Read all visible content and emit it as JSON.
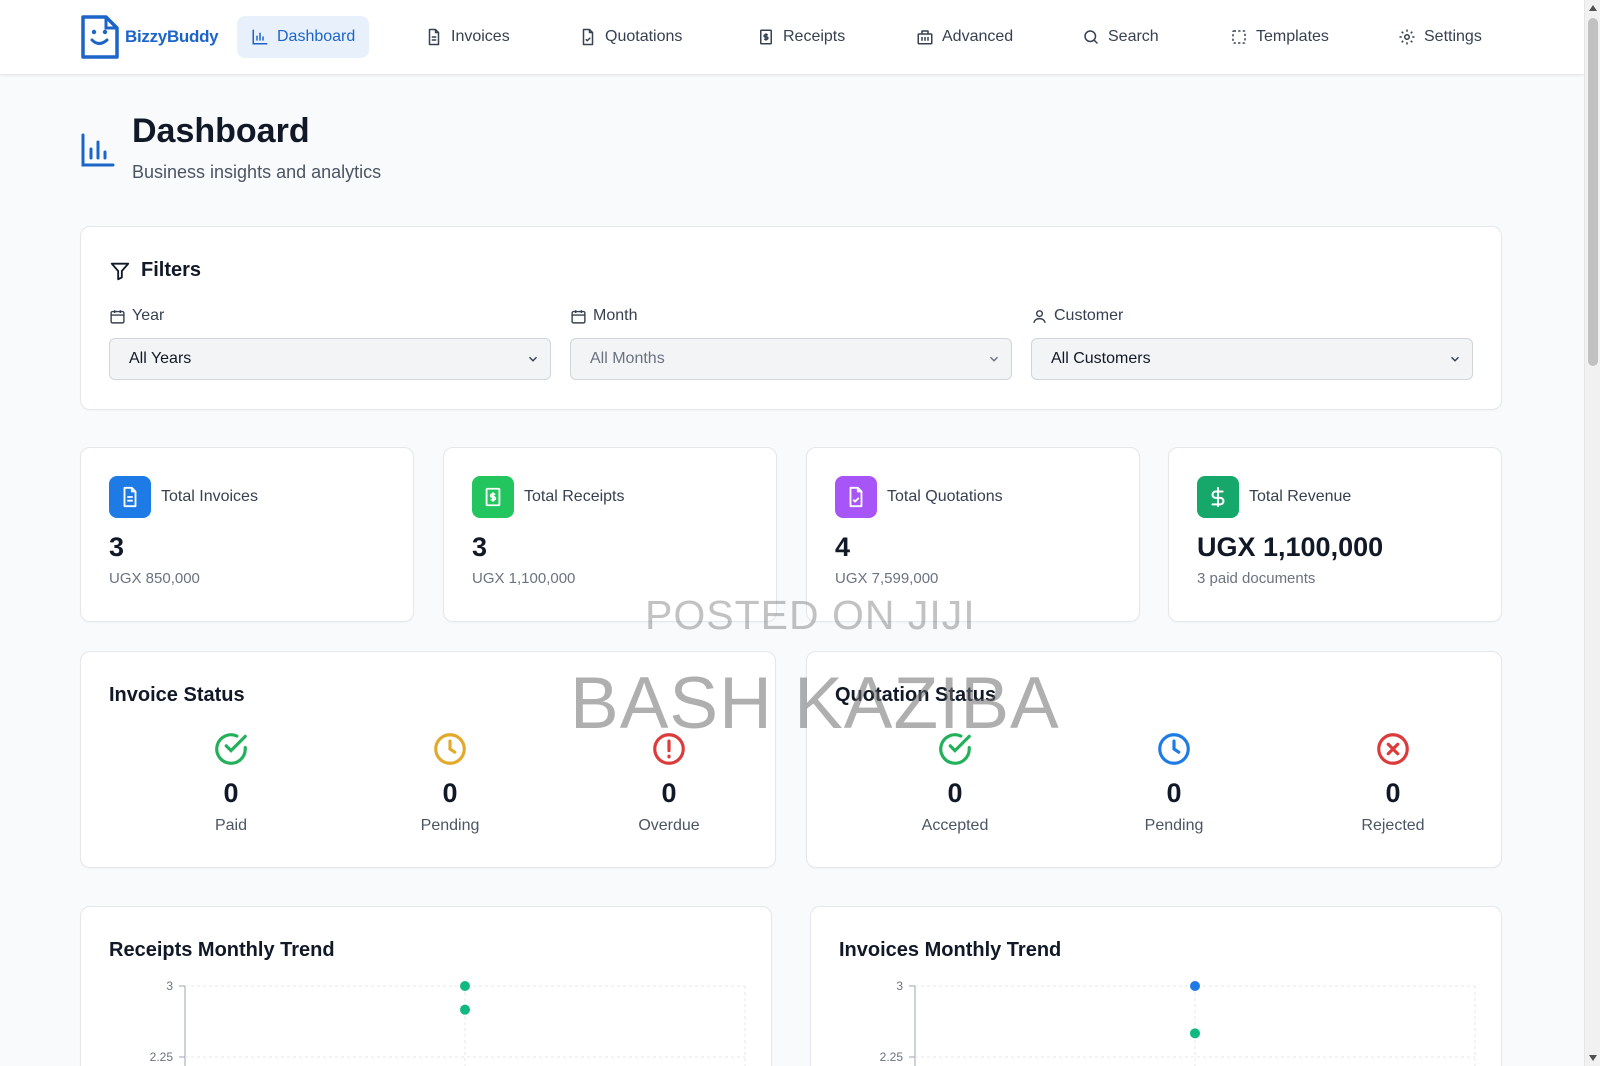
{
  "app": {
    "name": "BizzyBuddy"
  },
  "nav": {
    "dashboard": "Dashboard",
    "invoices": "Invoices",
    "quotations": "Quotations",
    "receipts": "Receipts",
    "advanced": "Advanced",
    "search": "Search",
    "templates": "Templates",
    "settings": "Settings",
    "active": "Dashboard"
  },
  "header": {
    "title": "Dashboard",
    "subtitle": "Business insights and analytics"
  },
  "filters": {
    "title": "Filters",
    "year": {
      "label": "Year",
      "value": "All Years"
    },
    "month": {
      "label": "Month",
      "value": "All Months"
    },
    "customer": {
      "label": "Customer",
      "value": "All Customers"
    }
  },
  "stats": {
    "invoices": {
      "label": "Total Invoices",
      "value": "3",
      "sub": "UGX 850,000",
      "color": "#1e7be6"
    },
    "receipts": {
      "label": "Total Receipts",
      "value": "3",
      "sub": "UGX 1,100,000",
      "color": "#22c55e"
    },
    "quotations": {
      "label": "Total Quotations",
      "value": "4",
      "sub": "UGX 7,599,000",
      "color": "#a855f7"
    },
    "revenue": {
      "label": "Total Revenue",
      "value": "UGX 1,100,000",
      "sub": "3 paid documents",
      "color": "#16a86a"
    }
  },
  "invoice_status": {
    "title": "Invoice Status",
    "paid": {
      "label": "Paid",
      "value": "0",
      "color": "#22b05a"
    },
    "pending": {
      "label": "Pending",
      "value": "0",
      "color": "#e3a92b"
    },
    "overdue": {
      "label": "Overdue",
      "value": "0",
      "color": "#dc3b3b"
    }
  },
  "quotation_status": {
    "title": "Quotation Status",
    "accepted": {
      "label": "Accepted",
      "value": "0",
      "color": "#22b05a"
    },
    "pending": {
      "label": "Pending",
      "value": "0",
      "color": "#1e7be6"
    },
    "rejected": {
      "label": "Rejected",
      "value": "0",
      "color": "#dc3b3b"
    }
  },
  "watermark": {
    "line1": "POSTED ON JIJI",
    "line2": "BASH KAZIBA"
  },
  "chart_data": [
    {
      "type": "scatter",
      "title": "Receipts Monthly Trend",
      "ytick_labels": [
        "3",
        "2.25"
      ],
      "series": [
        {
          "color": "#10b981",
          "x": [
            1
          ],
          "y": [
            3
          ]
        },
        {
          "color": "#10b981",
          "x": [
            1
          ],
          "y": [
            2.75
          ]
        }
      ]
    },
    {
      "type": "scatter",
      "title": "Invoices Monthly Trend",
      "ytick_labels": [
        "3",
        "2.25"
      ],
      "series": [
        {
          "color": "#1e7be6",
          "x": [
            1
          ],
          "y": [
            3
          ]
        },
        {
          "color": "#10b981",
          "x": [
            1
          ],
          "y": [
            2.5
          ]
        }
      ]
    }
  ]
}
